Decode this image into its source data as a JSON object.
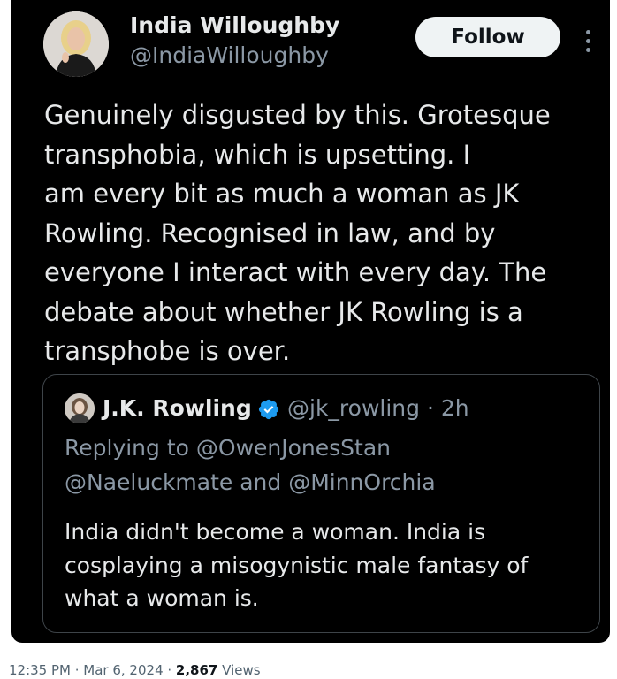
{
  "tweet": {
    "author_name": "India Willoughby",
    "author_handle": "@IndiaWilloughby",
    "follow_label": "Follow",
    "more_icon": "more-vertical-icon",
    "text_lines": [
      "Genuinely disgusted by this. Grotesque",
      "transphobia, which is upsetting. I",
      "am every bit as much a woman as JK",
      "Rowling. Recognised in law, and by",
      "everyone I interact with every day. The",
      "debate about whether JK Rowling is a",
      "transphobe is over."
    ]
  },
  "quoted": {
    "author_name": "J.K. Rowling",
    "verified_icon": "verified-badge-icon",
    "handle_time": "@jk_rowling · 2h",
    "replying_lines": [
      "Replying to @OwenJonesStan",
      "@Naeluckmate and @MinnOrchia"
    ],
    "text_lines": [
      "India didn't become a woman. India is",
      "cosplaying a misogynistic male fantasy of",
      "what a woman is."
    ]
  },
  "footer": {
    "timestamp": "12:35 PM · Mar 6, 2024 · ",
    "views_count": "2,867",
    "views_label": " Views"
  },
  "colors": {
    "card_background": "#000000",
    "primary_text": "#e7e9ea",
    "secondary_text": "#8b98a5",
    "verified_blue": "#1d9bf0",
    "follow_button": "#eff3f4"
  }
}
